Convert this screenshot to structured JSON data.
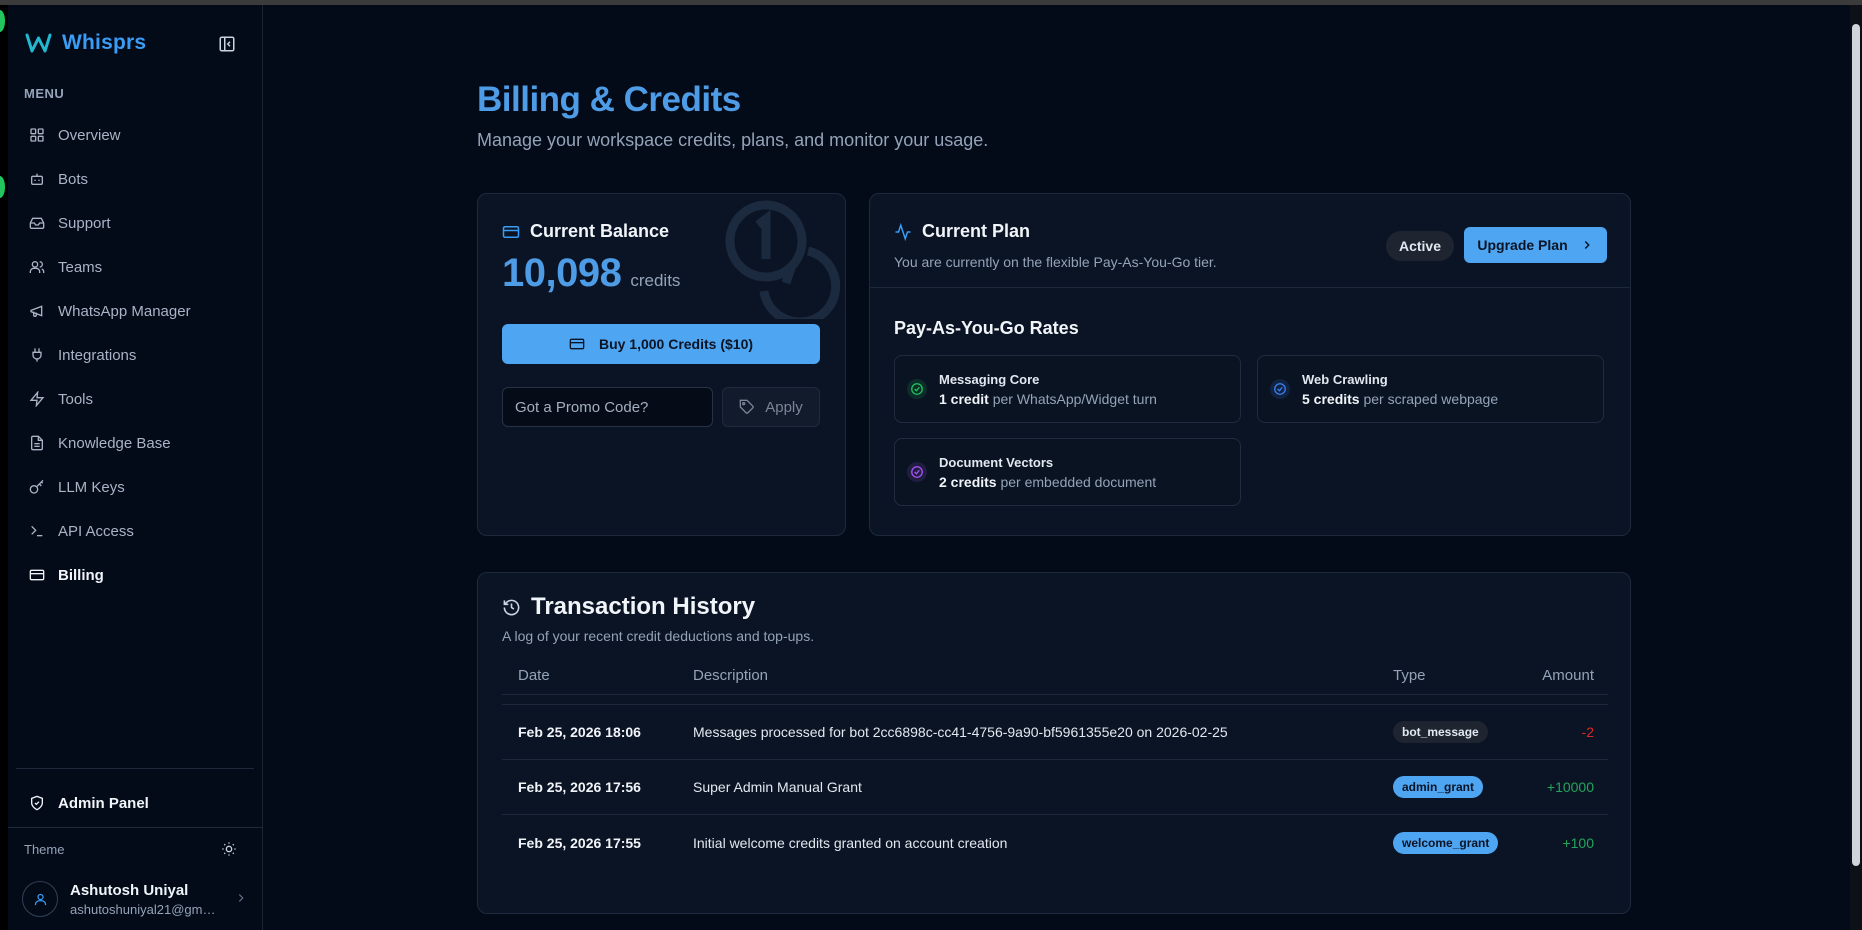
{
  "brand": {
    "name": "Whisprs"
  },
  "sidebar": {
    "menu_label": "MENU",
    "items": [
      {
        "label": "Overview",
        "icon": "grid-icon"
      },
      {
        "label": "Bots",
        "icon": "bot-icon"
      },
      {
        "label": "Support",
        "icon": "inbox-icon"
      },
      {
        "label": "Teams",
        "icon": "users-icon"
      },
      {
        "label": "WhatsApp Manager",
        "icon": "megaphone-icon"
      },
      {
        "label": "Integrations",
        "icon": "plug-icon"
      },
      {
        "label": "Tools",
        "icon": "zap-icon"
      },
      {
        "label": "Knowledge Base",
        "icon": "file-icon"
      },
      {
        "label": "LLM Keys",
        "icon": "key-icon"
      },
      {
        "label": "API Access",
        "icon": "terminal-icon"
      },
      {
        "label": "Billing",
        "icon": "credit-card-icon",
        "active": true
      }
    ],
    "admin_label": "Admin Panel",
    "theme_label": "Theme",
    "user": {
      "name": "Ashutosh Uniyal",
      "email": "ashutoshuniyal21@gma..."
    }
  },
  "page": {
    "title": "Billing & Credits",
    "subtitle": "Manage your workspace credits, plans, and monitor your usage."
  },
  "balance": {
    "title": "Current Balance",
    "value": "10,098",
    "unit": "credits",
    "buy_label": "Buy 1,000 Credits ($10)",
    "promo_placeholder": "Got a Promo Code?",
    "apply_label": "Apply"
  },
  "plan": {
    "title": "Current Plan",
    "subtitle": "You are currently on the flexible Pay-As-You-Go tier.",
    "status": "Active",
    "upgrade_label": "Upgrade Plan",
    "rates_title": "Pay-As-You-Go Rates",
    "rates": [
      {
        "name": "Messaging Core",
        "amount": "1 credit",
        "per": " per WhatsApp/Widget turn",
        "color": "#22c55e"
      },
      {
        "name": "Web Crawling",
        "amount": "5 credits",
        "per": " per scraped webpage",
        "color": "#3b82f6"
      },
      {
        "name": "Document Vectors",
        "amount": "2 credits",
        "per": " per embedded document",
        "color": "#a855f7"
      }
    ]
  },
  "history": {
    "title": "Transaction History",
    "subtitle": "A log of your recent credit deductions and top-ups.",
    "columns": {
      "date": "Date",
      "description": "Description",
      "type": "Type",
      "amount": "Amount"
    },
    "rows": [
      {
        "date": "Feb 25, 2026 18:06",
        "description": "Messages processed for bot 2cc6898c-cc41-4756-9a90-bf5961355e20 on 2026-02-25",
        "type": "bot_message",
        "amount": "-2"
      },
      {
        "date": "Feb 25, 2026 17:56",
        "description": "Super Admin Manual Grant",
        "type": "admin_grant",
        "amount": "+10000"
      },
      {
        "date": "Feb 25, 2026 17:55",
        "description": "Initial welcome credits granted on account creation",
        "type": "welcome_grant",
        "amount": "+100"
      }
    ]
  },
  "colors": {
    "accent": "#4ea5f2",
    "title": "#4e9be6",
    "negative": "#dc2626",
    "positive": "#22a55a",
    "background": "#030a18",
    "card": "#0b1424"
  }
}
